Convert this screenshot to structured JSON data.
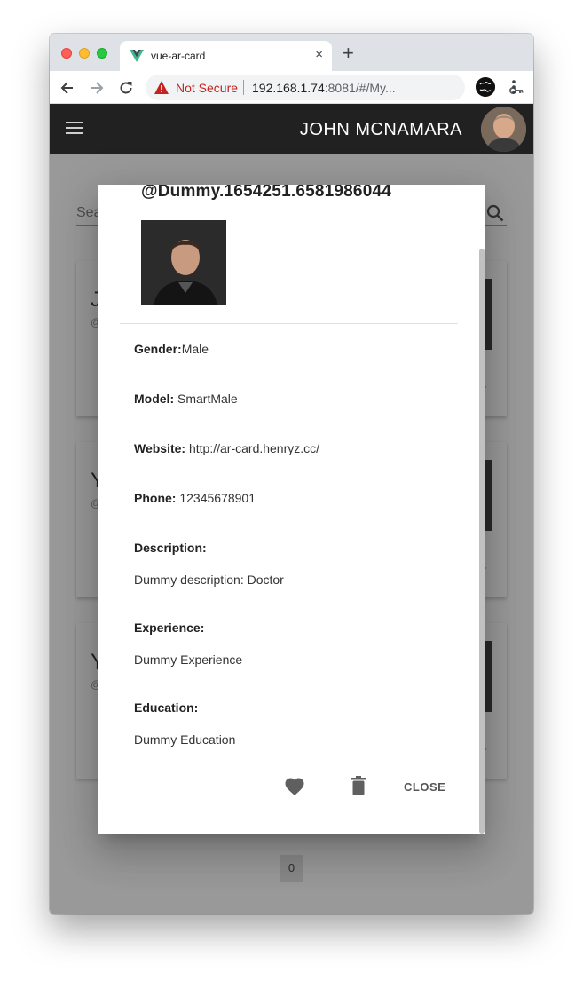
{
  "browser": {
    "tab_title": "vue-ar-card",
    "new_tab_symbol": "+",
    "close_symbol": "×",
    "security_label": "Not Secure",
    "url_host": "192.168.1.74",
    "url_rest": ":8081/#/My..."
  },
  "app": {
    "user_name": "JOHN MCNAMARA",
    "search_placeholder": "Sea"
  },
  "cards": [
    {
      "initial": "J",
      "handle": "@",
      "action": "ǐ"
    },
    {
      "initial": "Y",
      "handle": "@",
      "action": "ǐ"
    },
    {
      "initial": "Y",
      "handle": "@",
      "action": "ǐ"
    }
  ],
  "pagination": {
    "current": "0"
  },
  "dialog": {
    "title": "@Dummy.1654251.6581986044",
    "fields": [
      {
        "label": "Gender:",
        "value": "Male"
      },
      {
        "label": "Model:",
        "value": " SmartMale"
      },
      {
        "label": "Website:",
        "value": " http://ar-card.henryz.cc/"
      },
      {
        "label": "Phone:",
        "value": " 12345678901"
      },
      {
        "label": "Description:",
        "value": ""
      },
      {
        "label": "",
        "value": "Dummy description: Doctor"
      },
      {
        "label": "Experience:",
        "value": ""
      },
      {
        "label": "",
        "value": "Dummy Experience"
      },
      {
        "label": "Education:",
        "value": ""
      },
      {
        "label": "",
        "value": "Dummy Education"
      }
    ],
    "close_label": "CLOSE"
  },
  "icons": {
    "favicon": "vue-logo-icon",
    "back": "back-arrow-icon",
    "forward": "forward-arrow-icon",
    "reload": "reload-icon",
    "warning": "warning-triangle-icon",
    "key": "key-icon",
    "star": "star-icon",
    "menu": "hamburger-icon",
    "search": "search-icon",
    "favorite": "heart-icon",
    "delete": "trash-icon"
  },
  "colors": {
    "appbar": "#212121",
    "not_secure": "#c5221f",
    "vue_green": "#41b883",
    "vue_dark": "#35495e"
  }
}
